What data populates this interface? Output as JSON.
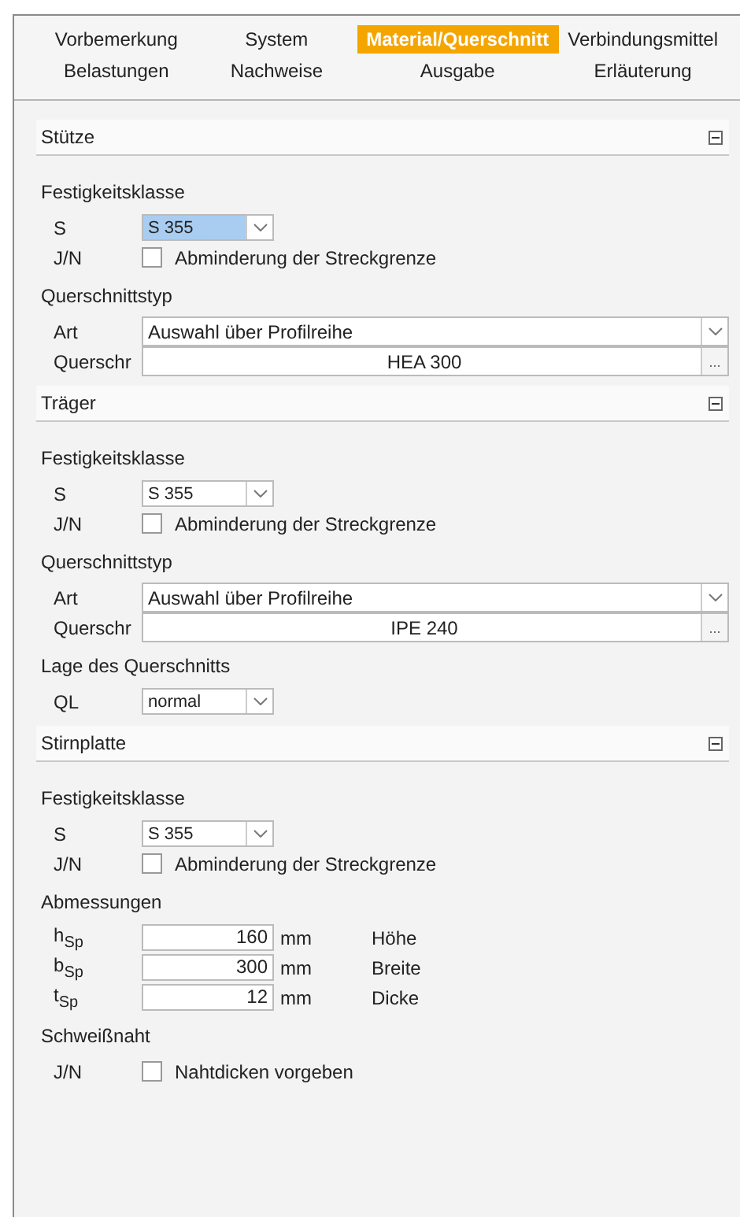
{
  "tabs": [
    {
      "label": "Vorbemerkung",
      "selected": false
    },
    {
      "label": "System",
      "selected": false
    },
    {
      "label": "Material/Querschnitt",
      "selected": true
    },
    {
      "label": "Verbindungsmittel",
      "selected": false
    },
    {
      "label": "Belastungen",
      "selected": false
    },
    {
      "label": "Nachweise",
      "selected": false
    },
    {
      "label": "Ausgabe",
      "selected": false
    },
    {
      "label": "Erläuterung",
      "selected": false
    }
  ],
  "sections": [
    {
      "title": "Stütze",
      "expanded": true,
      "groups": [
        {
          "heading": "Festigkeitsklasse",
          "rows": [
            {
              "kind": "combo",
              "label": "S",
              "value": "S 355",
              "focused": true
            },
            {
              "kind": "checkbox",
              "label": "J/N",
              "text": "Abminderung der Streckgrenze",
              "checked": false
            }
          ]
        },
        {
          "heading": "Querschnittstyp",
          "rows": [
            {
              "kind": "widecombo",
              "label": "Art",
              "value": "Auswahl über Profilreihe"
            },
            {
              "kind": "browse",
              "label": "Querschr",
              "value": "HEA 300",
              "button": "..."
            }
          ]
        }
      ]
    },
    {
      "title": "Träger",
      "expanded": true,
      "groups": [
        {
          "heading": "Festigkeitsklasse",
          "rows": [
            {
              "kind": "combo",
              "label": "S",
              "value": "S 355",
              "focused": false
            },
            {
              "kind": "checkbox",
              "label": "J/N",
              "text": "Abminderung der Streckgrenze",
              "checked": false
            }
          ]
        },
        {
          "heading": "Querschnittstyp",
          "rows": [
            {
              "kind": "widecombo",
              "label": "Art",
              "value": "Auswahl über Profilreihe"
            },
            {
              "kind": "browse",
              "label": "Querschr",
              "value": "IPE 240",
              "button": "..."
            }
          ]
        },
        {
          "heading": "Lage des Querschnitts",
          "rows": [
            {
              "kind": "combo",
              "label": "QL",
              "value": "normal",
              "focused": false
            }
          ]
        }
      ]
    },
    {
      "title": "Stirnplatte",
      "expanded": true,
      "groups": [
        {
          "heading": "Festigkeitsklasse",
          "rows": [
            {
              "kind": "combo",
              "label": "S",
              "value": "S 355",
              "focused": false
            },
            {
              "kind": "checkbox",
              "label": "J/N",
              "text": "Abminderung der Streckgrenze",
              "checked": false
            }
          ]
        },
        {
          "heading": "Abmessungen",
          "rows": [
            {
              "kind": "dimension",
              "label": "h$_{Sp}$",
              "value": "160",
              "unit": "mm",
              "note": "Höhe"
            },
            {
              "kind": "dimension",
              "label": "b$_{Sp}$",
              "value": "300",
              "unit": "mm",
              "note": "Breite"
            },
            {
              "kind": "dimension",
              "label": "t$_{Sp}$",
              "value": "12",
              "unit": "mm",
              "note": "Dicke"
            }
          ]
        },
        {
          "heading": "Schweißnaht",
          "rows": [
            {
              "kind": "checkbox",
              "label": "J/N",
              "text": "Nahtdicken vorgeben",
              "checked": false
            }
          ]
        }
      ]
    }
  ]
}
